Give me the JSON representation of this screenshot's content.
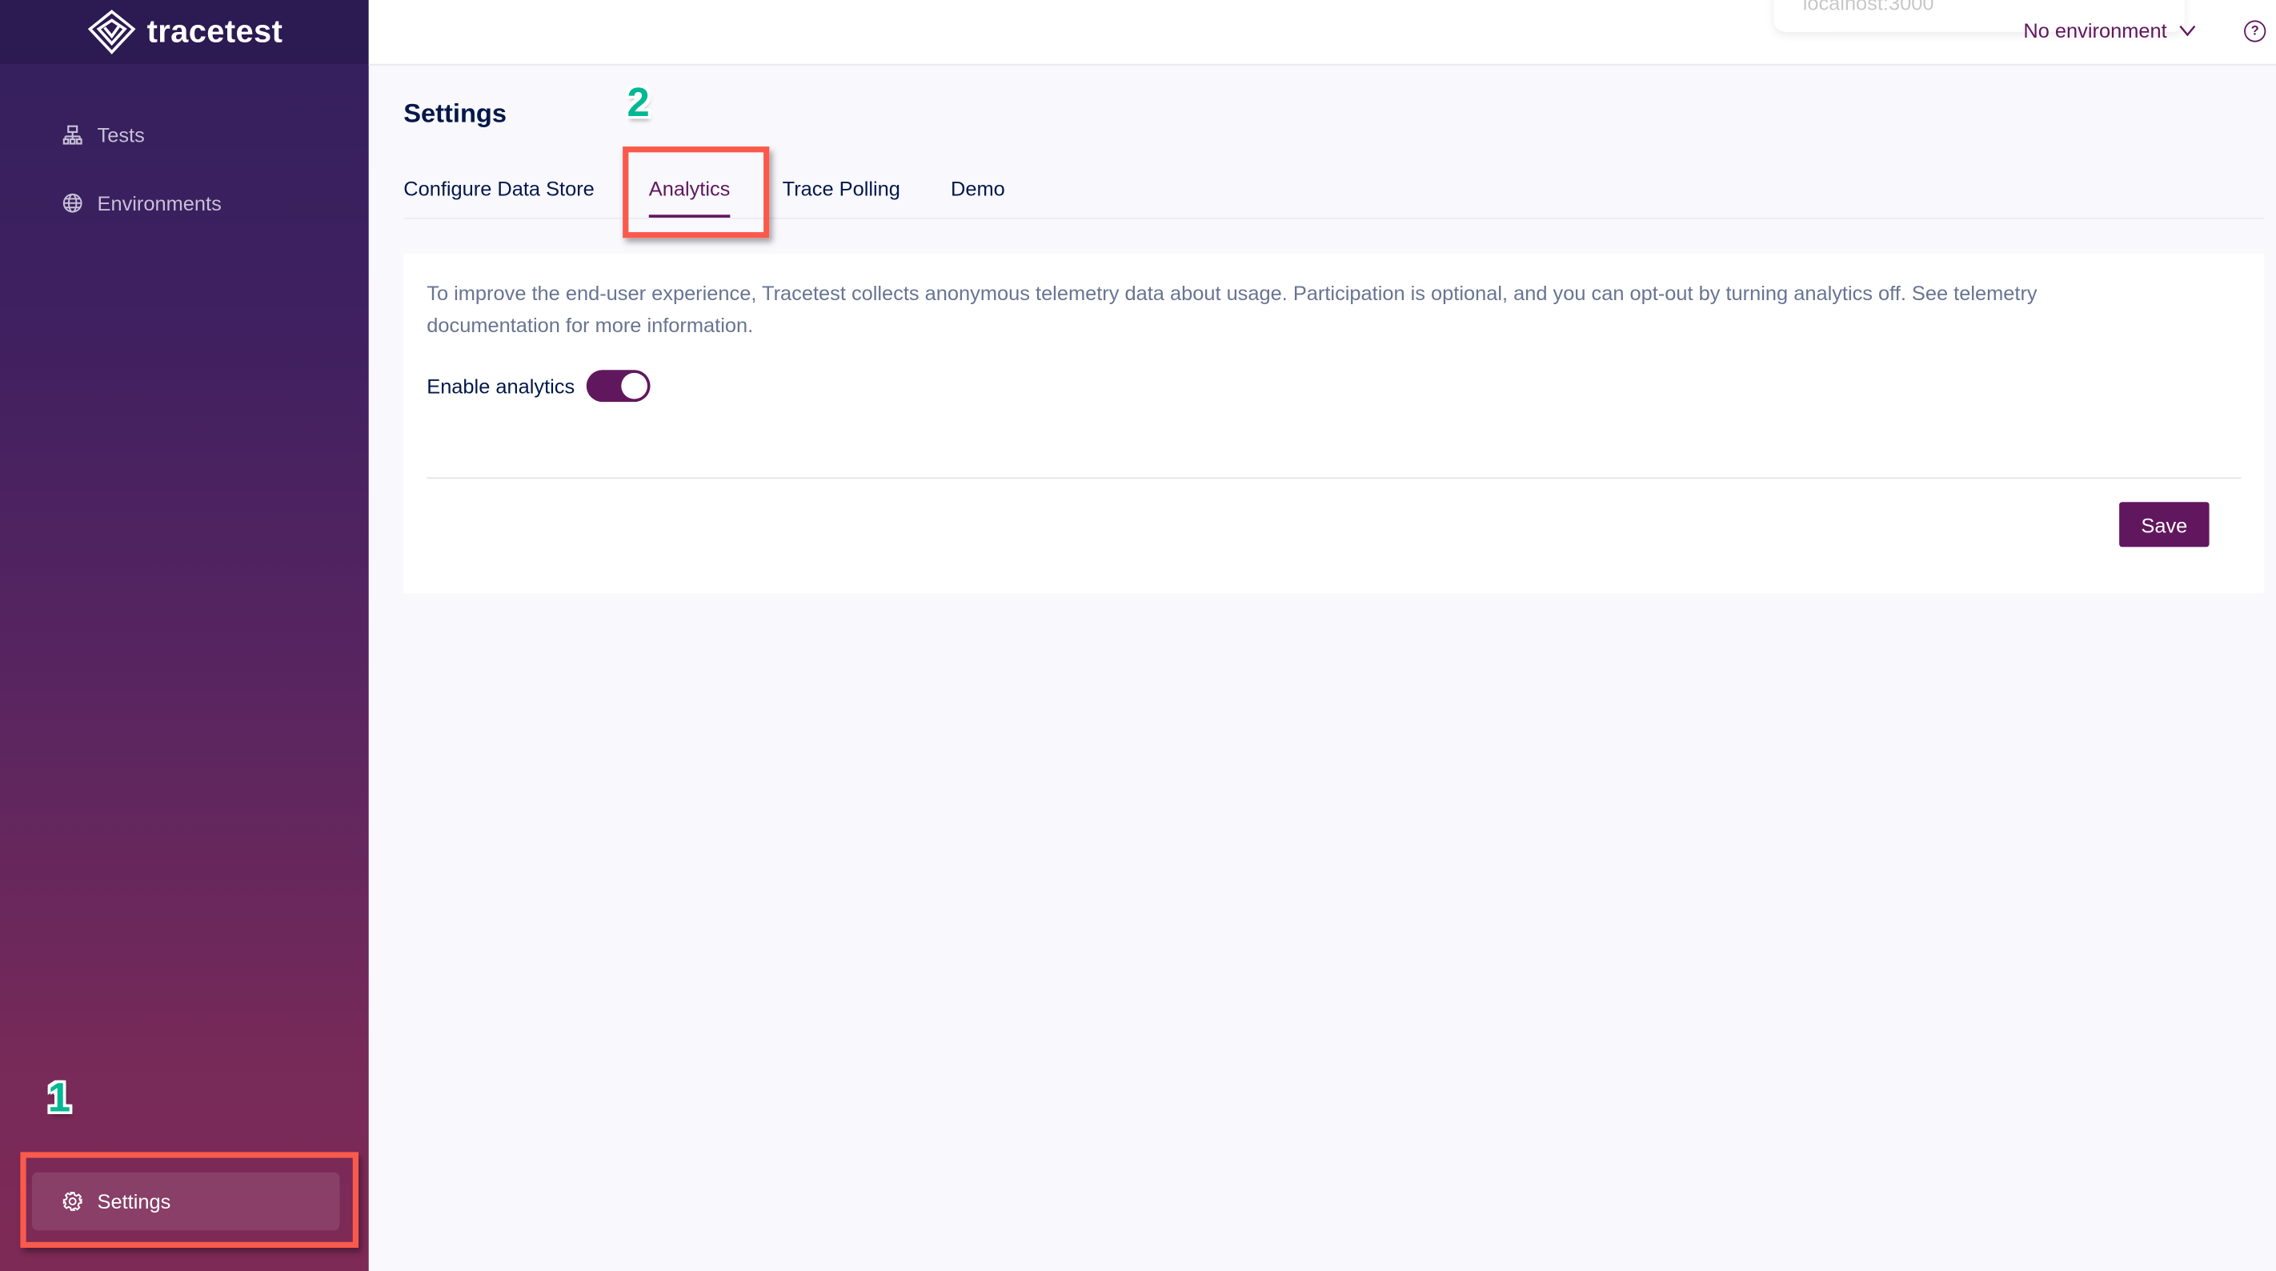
{
  "app": {
    "name": "tracetest"
  },
  "sidebar": {
    "items": [
      {
        "label": "Tests",
        "icon": "tests-icon"
      },
      {
        "label": "Environments",
        "icon": "globe-icon"
      }
    ],
    "settings": {
      "label": "Settings",
      "icon": "gear-icon"
    }
  },
  "header": {
    "popover_text": "localhost:3000",
    "environment": "No environment",
    "help_icon": "help-icon"
  },
  "page": {
    "title": "Settings",
    "tabs": [
      {
        "label": "Configure Data Store"
      },
      {
        "label": "Analytics",
        "active": true
      },
      {
        "label": "Trace Polling"
      },
      {
        "label": "Demo"
      }
    ],
    "analytics": {
      "description": "To improve the end-user experience, Tracetest collects anonymous telemetry data about usage. Participation is optional, and you can opt-out by turning analytics off. See telemetry documentation for more information.",
      "toggle_label": "Enable analytics",
      "enabled": true,
      "save_label": "Save"
    }
  },
  "annotations": {
    "step1": "1",
    "step2": "2"
  },
  "colors": {
    "accent": "#61175e",
    "annotation_box": "#fa5a4b",
    "annotation_number": "#00b894"
  }
}
